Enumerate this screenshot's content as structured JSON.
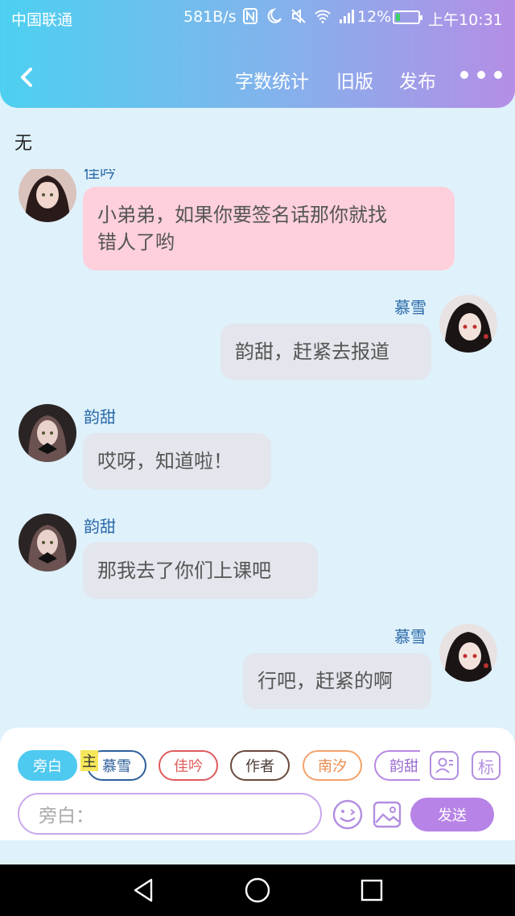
{
  "status_bar": {
    "carrier": "中国联通",
    "net_speed": "581B/s",
    "battery_percent": "12%",
    "time": "上午10:31"
  },
  "nav": {
    "word_count": "字数统计",
    "old_version": "旧版",
    "publish": "发布"
  },
  "section_label": "无",
  "messages": [
    {
      "sender": "佳吟",
      "text": "小弟弟，如果你要签名话那你就找错人了哟",
      "line1": "小弟弟，如果你要签名话那你就找",
      "line2": "错人了哟"
    },
    {
      "sender": "慕雪",
      "text": "韵甜，赶紧去报道"
    },
    {
      "sender": "韵甜",
      "text": "哎呀，知道啦！"
    },
    {
      "sender": "韵甜",
      "text": "那我去了你们上课吧"
    },
    {
      "sender": "慕雪",
      "text": "行吧，赶紧的啊"
    }
  ],
  "roles": [
    "旁白",
    "慕雪",
    "佳吟",
    "作者",
    "南汐",
    "韵甜"
  ],
  "main_tag": "主",
  "tools": {
    "mark": "标"
  },
  "input": {
    "placeholder": "旁白："
  },
  "send_label": "发送",
  "colors": {
    "header_start": "#4dd0f0",
    "header_end": "#b48ee6",
    "pink_bubble": "#fdd0dc",
    "gray_bubble": "#e3e6ec",
    "sender_name": "#2b6aa8",
    "send_button": "#b783e6"
  }
}
